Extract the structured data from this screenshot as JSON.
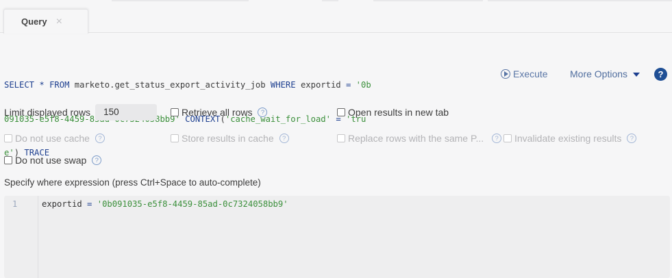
{
  "tab": {
    "label": "Query",
    "close": "×"
  },
  "sql": {
    "line1": [
      {
        "t": "SELECT",
        "k": "kw"
      },
      {
        "t": " "
      },
      {
        "t": "*",
        "k": "kw"
      },
      {
        "t": " "
      },
      {
        "t": "FROM",
        "k": "kw"
      },
      {
        "t": " marketo.get_status_export_activity_job "
      },
      {
        "t": "WHERE",
        "k": "kw"
      },
      {
        "t": " exportid "
      },
      {
        "t": "=",
        "k": "kw"
      },
      {
        "t": " "
      },
      {
        "t": "'0b",
        "k": "str"
      }
    ],
    "line2": [
      {
        "t": "091035-e5f8-4459-85ad-0c7324058bb9'",
        "k": "str"
      },
      {
        "t": " "
      },
      {
        "t": "CONTEXT",
        "k": "kw"
      },
      {
        "t": "("
      },
      {
        "t": "'cache_wait_for_load'",
        "k": "str"
      },
      {
        "t": " "
      },
      {
        "t": "=",
        "k": "kw"
      },
      {
        "t": " "
      },
      {
        "t": "'tru",
        "k": "str"
      }
    ],
    "line3": [
      {
        "t": "e'",
        "k": "str"
      },
      {
        "t": ") "
      },
      {
        "t": "TRACE",
        "k": "kw"
      }
    ]
  },
  "actions": {
    "execute": "Execute",
    "more_options": "More Options",
    "help": "?"
  },
  "options": {
    "limit_label": "Limit displayed rows",
    "limit_value": "150",
    "retrieve_all": "Retrieve all rows",
    "open_new_tab": "Open results in new tab",
    "no_cache": "Do not use cache",
    "store_cache": "Store results in cache",
    "replace_rows": "Replace rows with the same P...",
    "invalidate": "Invalidate existing results",
    "no_swap": "Do not use swap",
    "help_glyph": "?"
  },
  "where": {
    "label": "Specify where expression (press Ctrl+Space to auto-complete)",
    "line_number": "1",
    "code": [
      {
        "t": "exportid "
      },
      {
        "t": "=",
        "k": "kw"
      },
      {
        "t": " "
      },
      {
        "t": "'0b091035-e5f8-4459-85ad-0c7324058bb9'",
        "k": "str"
      }
    ]
  }
}
